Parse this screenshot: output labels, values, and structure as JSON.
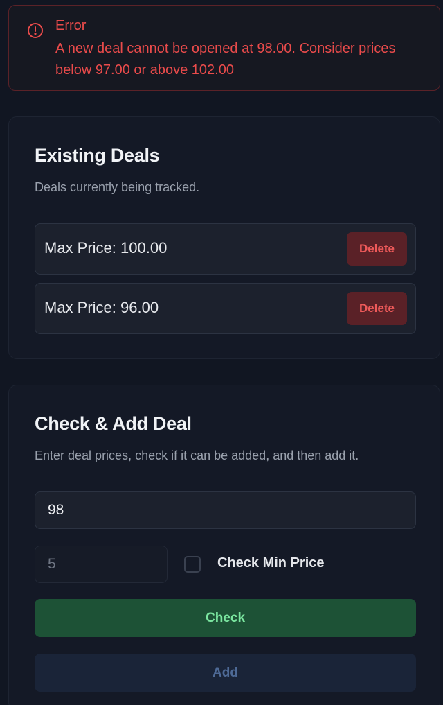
{
  "alert": {
    "icon": "alert-circle-icon",
    "color": "#ea4b4b",
    "title": "Error",
    "message": "A new deal cannot be opened at 98.00. Consider prices below 97.00 or above 102.00"
  },
  "existing_deals": {
    "title": "Existing Deals",
    "description": "Deals currently being tracked.",
    "deals": [
      {
        "label": "Max Price: 100.00",
        "delete_label": "Delete"
      },
      {
        "label": "Max Price: 96.00",
        "delete_label": "Delete"
      }
    ]
  },
  "check_add": {
    "title": "Check & Add Deal",
    "description": "Enter deal prices, check if it can be added, and then add it.",
    "price_input": {
      "value": "98"
    },
    "min_price_input": {
      "value": "5",
      "disabled": true
    },
    "check_min_price": {
      "label": "Check Min Price",
      "checked": false
    },
    "check_button": {
      "label": "Check",
      "color": "#1d5236"
    },
    "add_button": {
      "label": "Add",
      "disabled": true
    }
  }
}
